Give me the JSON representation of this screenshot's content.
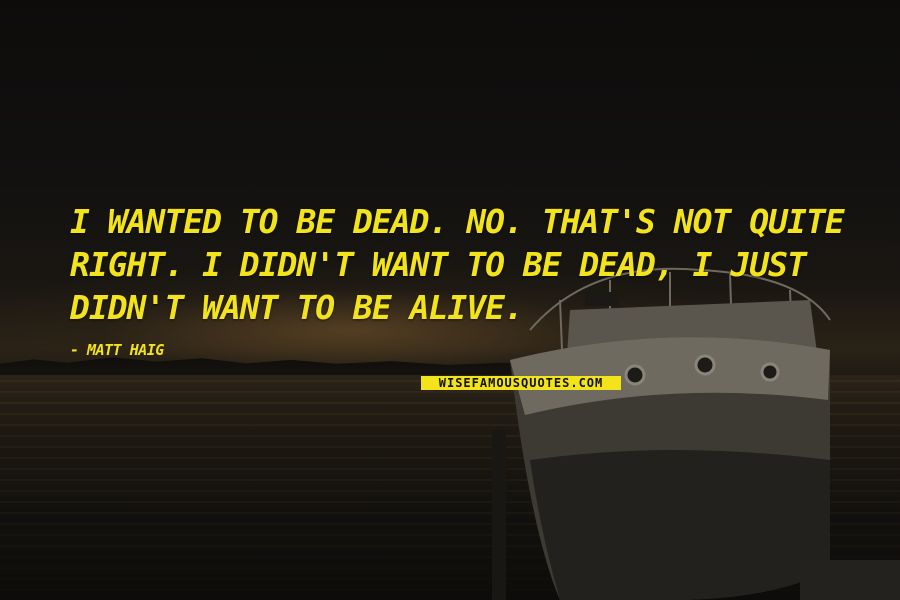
{
  "quote": {
    "text": "I WANTED TO BE DEAD. NO. THAT'S NOT QUITE RIGHT. I DIDN'T WANT TO BE DEAD, I JUST DIDN'T WANT TO BE ALIVE.",
    "author": "- MATT HAIG"
  },
  "watermark": {
    "text": "WISEFAMOUSQUOTES.COM"
  },
  "colors": {
    "quote_text": "#f2e31b",
    "watermark_bg": "#f2e31b",
    "sky": "#121110",
    "water": "#1d1912"
  }
}
